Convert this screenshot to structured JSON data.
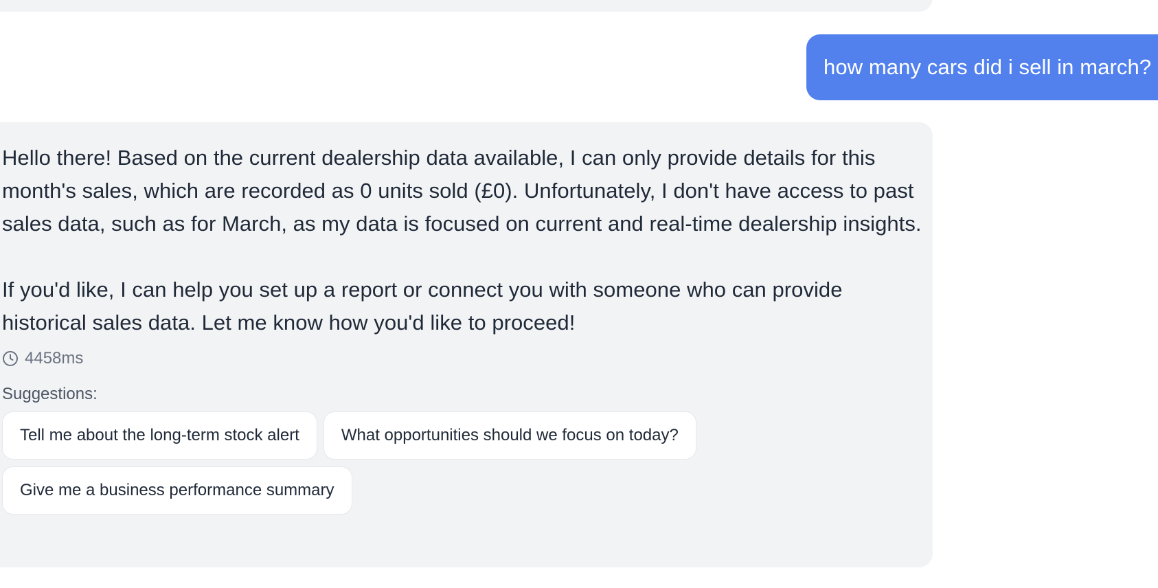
{
  "conversation": {
    "user_message": "how many cars did i sell in march?",
    "assistant": {
      "paragraphs": [
        "Hello there! Based on the current dealership data available, I can only provide details for this month's sales, which are recorded as 0 units sold (£0). Unfortunately, I don't have access to past sales data, such as for March, as my data is focused on current and real-time dealership insights.",
        "If you'd like, I can help you set up a report or connect you with someone who can provide historical sales data. Let me know how you'd like to proceed!"
      ],
      "response_time": "4458ms",
      "response_time_icon": "clock-icon",
      "suggestions_label": "Suggestions:",
      "suggestions": [
        "Tell me about the long-term stock alert",
        "What opportunities should we focus on today?",
        "Give me a business performance summary"
      ]
    }
  },
  "colors": {
    "user_bubble": "#5281ee",
    "assistant_bubble": "#f2f3f5",
    "text": "#1f2937",
    "muted_text": "#6b7280"
  }
}
